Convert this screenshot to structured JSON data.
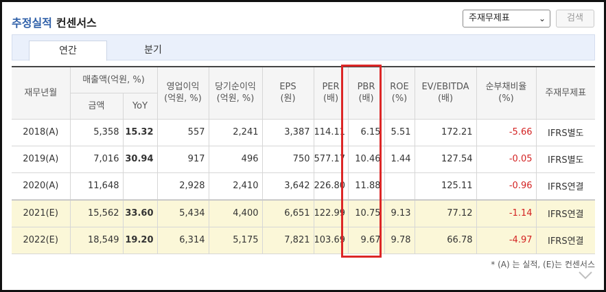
{
  "header": {
    "title": "추정실적",
    "subtitle": "컨센서스"
  },
  "controls": {
    "select_value": "주재무제표",
    "search_label": "검색"
  },
  "tabs": [
    {
      "label": "연간",
      "active": true
    },
    {
      "label": "분기",
      "active": false
    }
  ],
  "table": {
    "headers": {
      "year": "재무년월",
      "sales_group": "매출액(억원, %)",
      "sales_amount": "금액",
      "sales_yoy": "YoY",
      "op_income": [
        "영업이익",
        "(억원, %)"
      ],
      "net_income": [
        "당기순이익",
        "(억원, %)"
      ],
      "eps": [
        "EPS",
        "(원)"
      ],
      "per": [
        "PER",
        "(배)"
      ],
      "pbr": [
        "PBR",
        "(배)"
      ],
      "roe": [
        "ROE",
        "(%)"
      ],
      "ev_ebitda": [
        "EV/EBITDA",
        "(배)"
      ],
      "net_debt": [
        "순부채비율",
        "(%)"
      ],
      "main_fs": "주재무제표"
    },
    "rows": [
      {
        "year": "2018(A)",
        "sales": "5,358",
        "yoy": "15.32",
        "op": "557",
        "net": "2,241",
        "eps": "3,387",
        "per": "114.11",
        "pbr": "6.15",
        "roe": "5.51",
        "ev": "172.21",
        "debt": "-5.66",
        "fs": "IFRS별도",
        "estimate": false
      },
      {
        "year": "2019(A)",
        "sales": "7,016",
        "yoy": "30.94",
        "op": "917",
        "net": "496",
        "eps": "750",
        "per": "577.17",
        "pbr": "10.46",
        "roe": "1.44",
        "ev": "127.54",
        "debt": "-0.05",
        "fs": "IFRS별도",
        "estimate": false
      },
      {
        "year": "2020(A)",
        "sales": "11,648",
        "yoy": "",
        "op": "2,928",
        "net": "2,410",
        "eps": "3,642",
        "per": "226.80",
        "pbr": "11.88",
        "roe": "",
        "ev": "125.11",
        "debt": "-0.96",
        "fs": "IFRS연결",
        "estimate": false
      },
      {
        "year": "2021(E)",
        "sales": "15,562",
        "yoy": "33.60",
        "op": "5,434",
        "net": "4,400",
        "eps": "6,651",
        "per": "122.99",
        "pbr": "10.75",
        "roe": "9.13",
        "ev": "77.12",
        "debt": "-1.14",
        "fs": "IFRS연결",
        "estimate": true
      },
      {
        "year": "2022(E)",
        "sales": "18,549",
        "yoy": "19.20",
        "op": "6,314",
        "net": "5,175",
        "eps": "7,821",
        "per": "103.69",
        "pbr": "9.67",
        "roe": "9.78",
        "ev": "66.78",
        "debt": "-4.97",
        "fs": "IFRS연결",
        "estimate": true
      }
    ]
  },
  "footnote": "* (A) 는 실적, (E)는 컨센서스",
  "colors": {
    "title_blue": "#2e5fa8",
    "negative_red": "#d32222",
    "estimate_bg": "#fbf7d8",
    "highlight_red": "#dc2626",
    "tab_bg": "#eaf0fb"
  }
}
